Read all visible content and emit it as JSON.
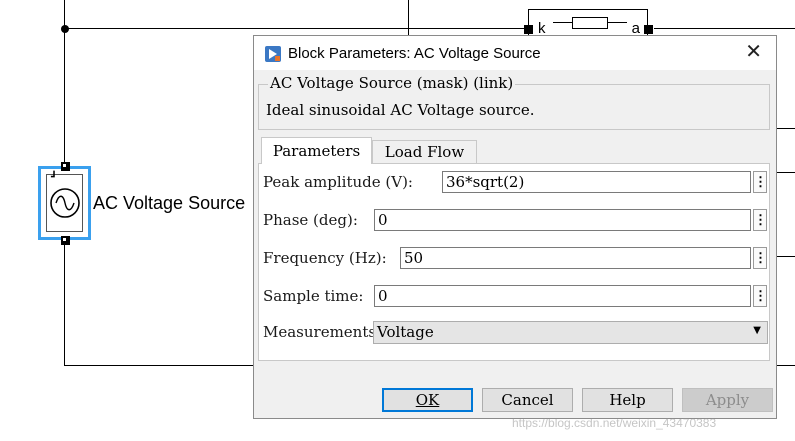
{
  "canvas": {
    "block_label": "AC Voltage Source",
    "top_block_left_port": "k",
    "top_block_right_port": "a"
  },
  "dialog": {
    "title": "Block Parameters: AC Voltage Source",
    "mask_header": "AC Voltage Source (mask) (link)",
    "description": "Ideal sinusoidal AC Voltage source.",
    "tabs": [
      {
        "label": "Parameters",
        "active": true
      },
      {
        "label": "Load Flow",
        "active": false
      }
    ],
    "params": {
      "peak_amplitude": {
        "label": "Peak amplitude (V):",
        "value": "36*sqrt(2)"
      },
      "phase": {
        "label": "Phase (deg):",
        "value": "0"
      },
      "frequency": {
        "label": "Frequency (Hz):",
        "value": "50"
      },
      "sample_time": {
        "label": "Sample time:",
        "value": "0"
      },
      "measurements": {
        "label": "Measurements",
        "value": "Voltage"
      }
    },
    "buttons": {
      "ok": "OK",
      "cancel": "Cancel",
      "help": "Help",
      "apply": "Apply"
    }
  },
  "watermark": "https://blog.csdn.net/weixin_43470383",
  "colors": {
    "selection": "#3aa0ee",
    "dialog_bg": "#f0f0f0",
    "ok_border": "#0078d7"
  }
}
